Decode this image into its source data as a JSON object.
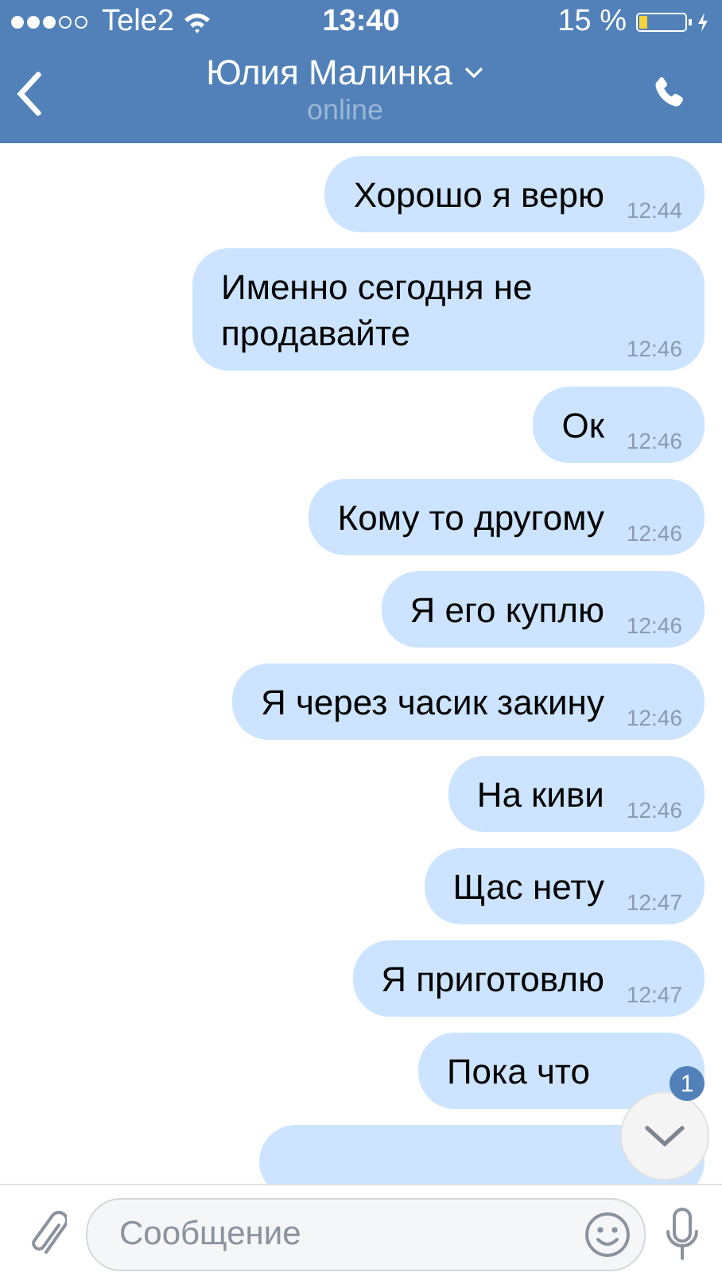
{
  "status_bar": {
    "carrier": "Tele2",
    "time": "13:40",
    "battery": "15 %"
  },
  "header": {
    "title": "Юлия Малинка",
    "subtitle": "online"
  },
  "messages": [
    {
      "text": "Хорошо я верю",
      "time": "12:44"
    },
    {
      "text": "Именно сегодня не продавайте",
      "time": "12:46"
    },
    {
      "text": "Ок",
      "time": "12:46"
    },
    {
      "text": "Кому то другому",
      "time": "12:46"
    },
    {
      "text": "Я его куплю",
      "time": "12:46"
    },
    {
      "text": "Я через часик закину",
      "time": "12:46"
    },
    {
      "text": "На киви",
      "time": "12:46"
    },
    {
      "text": "Щас нету",
      "time": "12:47"
    },
    {
      "text": "Я приготовлю",
      "time": "12:47"
    },
    {
      "text": "Пока что"
    }
  ],
  "scroll_down": {
    "badge": "1"
  },
  "composer": {
    "placeholder": "Сообщение"
  }
}
